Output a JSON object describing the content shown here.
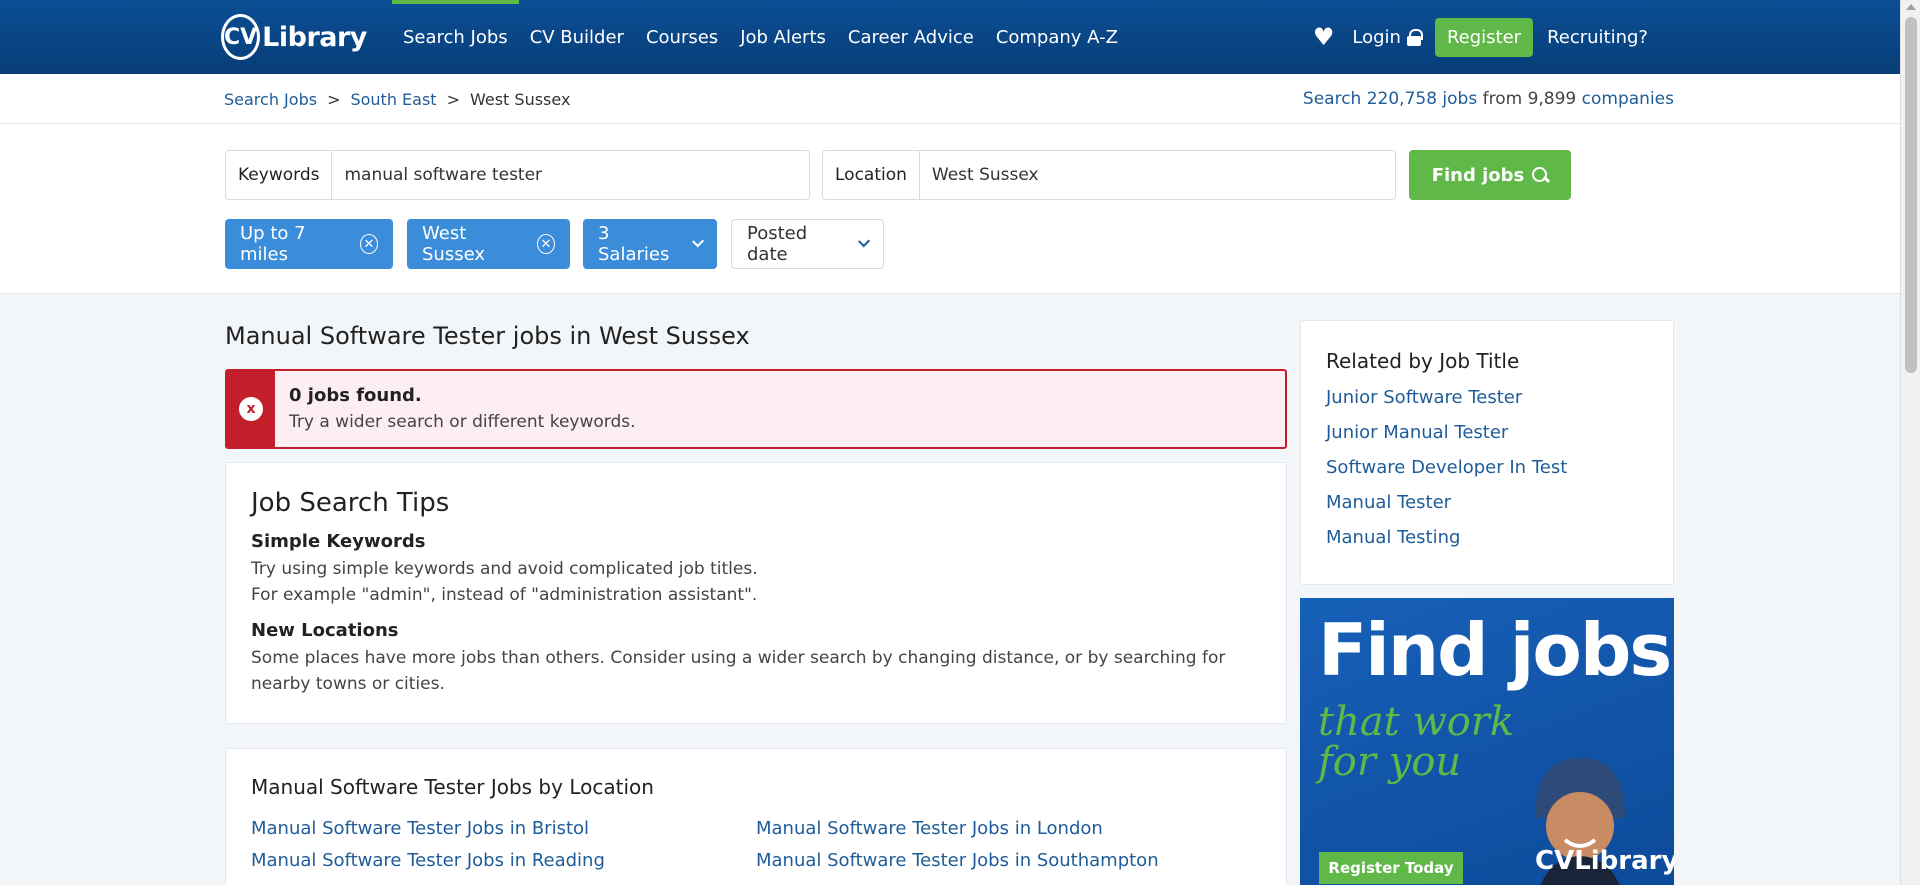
{
  "header": {
    "logo_text": "Library",
    "logo_badge": "CV",
    "nav": [
      {
        "label": "Search Jobs",
        "active": true
      },
      {
        "label": "CV Builder"
      },
      {
        "label": "Courses"
      },
      {
        "label": "Job Alerts"
      },
      {
        "label": "Career Advice"
      },
      {
        "label": "Company A-Z"
      }
    ],
    "login_label": "Login",
    "register_label": "Register",
    "recruiting_label": "Recruiting?"
  },
  "breadcrumb": {
    "items": [
      "Search Jobs",
      "South East",
      "West Sussex"
    ],
    "separator": ">"
  },
  "stats": {
    "prefix": "Search",
    "jobs": "220,758 jobs",
    "middle": "from 9,899",
    "companies": "companies"
  },
  "search": {
    "keywords_label": "Keywords",
    "keywords_value": "manual software tester",
    "location_label": "Location",
    "location_value": "West Sussex",
    "find_label": "Find jobs"
  },
  "filters": [
    {
      "label": "Up to 7 miles",
      "type": "removable"
    },
    {
      "label": "West Sussex",
      "type": "removable"
    },
    {
      "label": "3 Salaries",
      "type": "dropdown"
    },
    {
      "label": "Posted date",
      "type": "dropdown"
    }
  ],
  "main": {
    "title": "Manual Software Tester jobs in West Sussex",
    "alert_title": "0 jobs found.",
    "alert_text": "Try a wider search or different keywords.",
    "alert_icon": "x"
  },
  "tips": {
    "title": "Job Search Tips",
    "h1": "Simple Keywords",
    "l1": "Try using simple keywords and avoid complicated job titles.",
    "l2": "For example \"admin\", instead of \"administration assistant\".",
    "h2": "New Locations",
    "l3": "Some places have more jobs than others. Consider using a wider search by changing distance, or by searching for nearby towns or cities."
  },
  "locations": {
    "title": "Manual Software Tester Jobs by Location",
    "links": [
      "Manual Software Tester Jobs in Bristol",
      "Manual Software Tester Jobs in London",
      "Manual Software Tester Jobs in Reading",
      "Manual Software Tester Jobs in Southampton"
    ]
  },
  "related": {
    "title": "Related by Job Title",
    "links": [
      "Junior Software Tester",
      "Junior Manual Tester",
      "Software Developer In Test",
      "Manual Tester",
      "Manual Testing"
    ]
  },
  "ad": {
    "title": "Find jobs",
    "sub1": "that work",
    "sub2": "for you",
    "button": "Register Today",
    "logo": "CVLibrary"
  },
  "colors": {
    "brand_blue": "#0b4f95",
    "accent_green": "#60b848",
    "chip_blue": "#3b8dd9",
    "alert_red": "#c21f2a",
    "link": "#1f5c99"
  }
}
